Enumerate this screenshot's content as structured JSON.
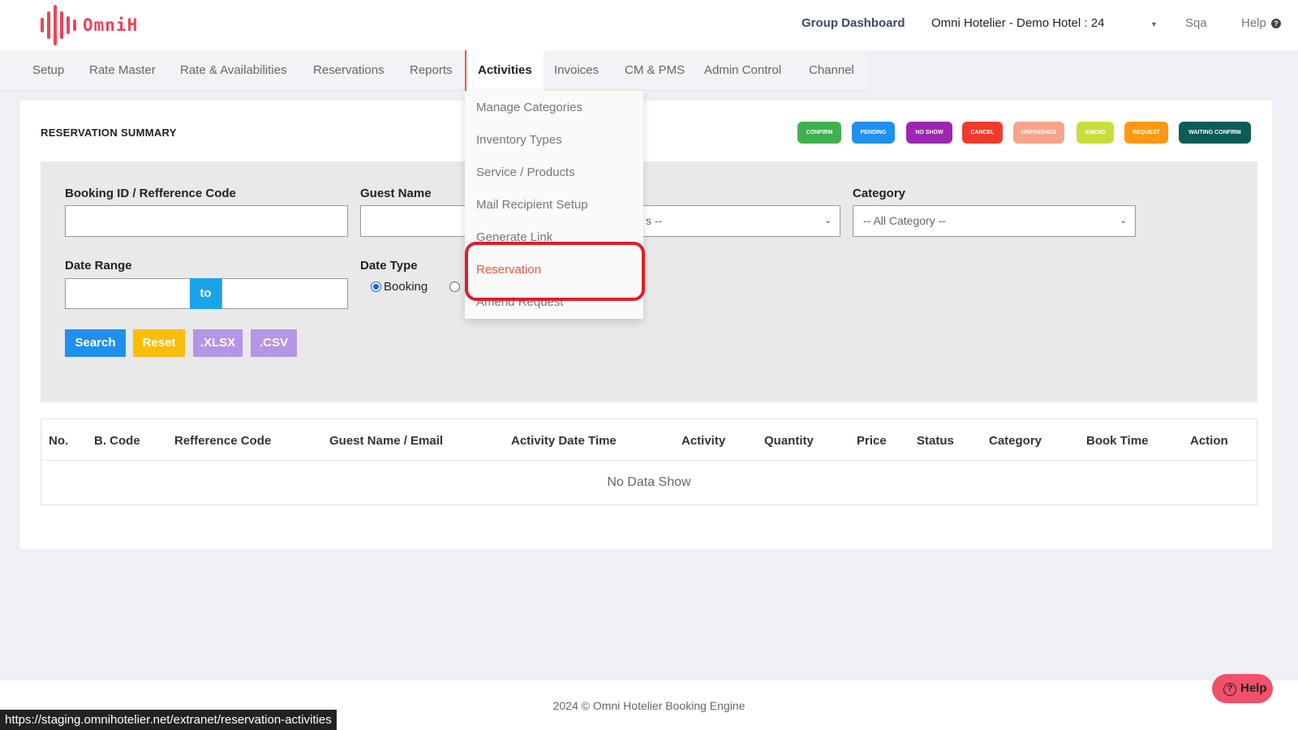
{
  "header": {
    "logo_text": "OmniH",
    "group_dashboard": "Group Dashboard",
    "hotel_name": "Omni Hotelier - Demo Hotel : 24",
    "user": "Sqa",
    "help": "Help"
  },
  "nav": {
    "items": [
      "Setup",
      "Rate Master",
      "Rate & Availabilities",
      "Reservations",
      "Reports",
      "Activities",
      "Invoices",
      "CM & PMS",
      "Admin Control",
      "Channel"
    ],
    "active": "Activities"
  },
  "summary_title": "RESERVATION SUMMARY",
  "legend": [
    {
      "label": "CONFIRM",
      "color": "#3fb04f"
    },
    {
      "label": "PENDING",
      "color": "#1e90f0"
    },
    {
      "label": "NO SHOW",
      "color": "#9c27b0"
    },
    {
      "label": "CANCEL",
      "color": "#ef3b2d"
    },
    {
      "label": "UNFINISHED",
      "color": "#f6a58c"
    },
    {
      "label": "AMEND",
      "color": "#c9de3a"
    },
    {
      "label": "REQUEST",
      "color": "#ff9812"
    },
    {
      "label": "WAITING CONFIRM",
      "color": "#0b5d57"
    }
  ],
  "filters": {
    "booking_id_label": "Booking ID / Refference Code",
    "guest_name_label": "Guest Name",
    "status_select_value": "s --",
    "category_label": "Category",
    "category_value": "-- All Category --",
    "date_range_label": "Date Range",
    "to_label": "to",
    "date_type_label": "Date Type",
    "date_type_options": [
      "Booking",
      ""
    ],
    "date_type_selected": "Booking"
  },
  "buttons": {
    "search": "Search",
    "reset": "Reset",
    "xlsx": ".XLSX",
    "csv": ".CSV"
  },
  "table": {
    "headers": [
      "No.",
      "B. Code",
      "Refference Code",
      "Guest Name / Email",
      "Activity Date Time",
      "Activity",
      "Quantity",
      "Price",
      "Status",
      "Category",
      "Book Time",
      "Action"
    ],
    "empty_text": "No Data Show"
  },
  "dropdown": {
    "items": [
      "Manage Categories",
      "Inventory Types",
      "Service / Products",
      "Mail Recipient Setup",
      "Generate Link",
      "Reservation",
      "Amend Request"
    ],
    "highlighted": "Reservation"
  },
  "footer": {
    "text": "2024 © Omni Hotelier Booking Engine",
    "help_button": "Help"
  },
  "status_url": "https://staging.omnihotelier.net/extranet/reservation-activities"
}
